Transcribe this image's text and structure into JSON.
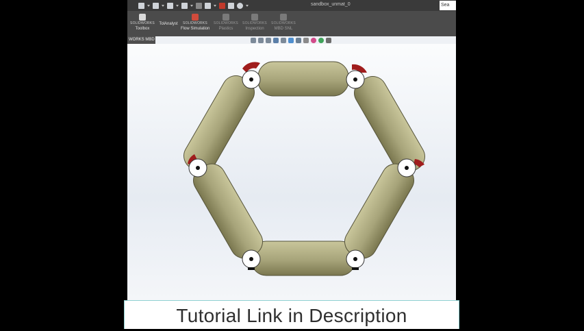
{
  "app": {
    "window_title": "sandbox_unmat_0",
    "search_placeholder": "Sea"
  },
  "ribbon": {
    "buttons": [
      {
        "brand": "SOLIDWORKS",
        "label": "Toolbox",
        "icon_color": "#d9d9d9"
      },
      {
        "brand": "",
        "label": "TolAnalyst",
        "icon_color": "#6aa0d8"
      },
      {
        "brand": "SOLIDWORKS",
        "label": "Flow Simulation",
        "icon_color": "#d04b3c"
      },
      {
        "brand": "SOLIDWORKS",
        "label": "Plastics",
        "icon_color": "#8a8a8a"
      },
      {
        "brand": "SOLIDWORKS",
        "label": "Inspection",
        "icon_color": "#8a8a8a"
      },
      {
        "brand": "SOLIDWORKS",
        "label": "MBD SNL",
        "icon_color": "#8a8a8a"
      }
    ]
  },
  "tab": {
    "label": "WORKS MBD"
  },
  "banner": {
    "text": "Tutorial Link in Description"
  },
  "colors": {
    "link_fill": "#b9b688",
    "link_dark": "#6f6c4a",
    "joint_red": "#a01d1d",
    "background": "#000000"
  }
}
